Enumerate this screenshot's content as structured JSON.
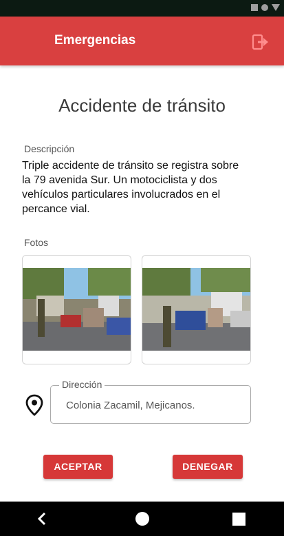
{
  "app_bar": {
    "title": "Emergencias",
    "logout_icon": "logout-icon",
    "color": "#d94040"
  },
  "report": {
    "title": "Accidente de tránsito",
    "description_label": "Descripción",
    "description": "Triple accidente de tránsito se registra sobre la 79 avenida Sur. Un motociclista y dos vehículos particulares involucrados en el percance vial.",
    "photos_label": "Fotos",
    "photos": [
      {
        "icon": "accident-photo-1"
      },
      {
        "icon": "accident-photo-2"
      }
    ],
    "address_label": "Dirección",
    "address_value": "Colonia Zacamil, Mejicanos.",
    "location_icon": "location-pin-icon"
  },
  "actions": {
    "accept_label": "ACEPTAR",
    "deny_label": "DENEGAR",
    "color": "#d63838"
  },
  "system_nav": {
    "back_icon": "back-icon",
    "home_icon": "home-icon",
    "recents_icon": "recents-icon"
  }
}
